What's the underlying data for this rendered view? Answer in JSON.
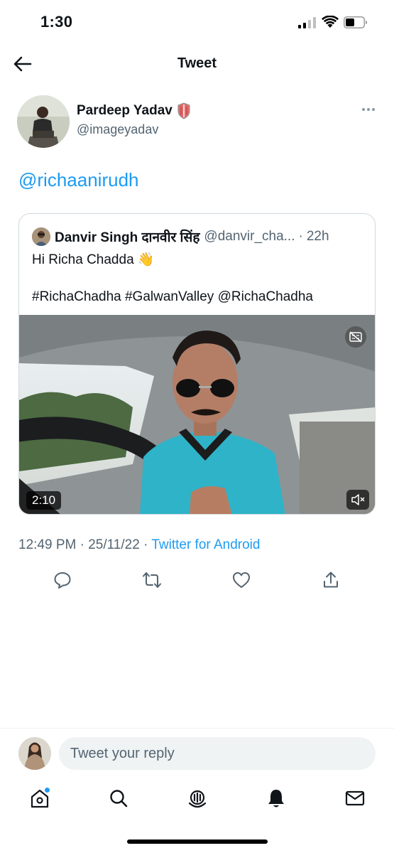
{
  "status_bar": {
    "time": "1:30"
  },
  "header": {
    "title": "Tweet"
  },
  "tweet": {
    "author_name": "Pardeep Yadav",
    "author_handle": "@imageyadav",
    "text": "@richaanirudh",
    "timestamp": "12:49 PM",
    "date": "25/11/22",
    "source": "Twitter for Android",
    "separator": "·"
  },
  "quoted_tweet": {
    "author_name": "Danvir Singh दानवीर सिंह",
    "author_handle": "@danvir_cha...",
    "age": "22h",
    "separator": "·",
    "line1": "Hi Richa Chadda 👋",
    "line2": "#RichaChadha #GalwanValley @RichaChadha",
    "video_duration": "2:10"
  },
  "reply": {
    "placeholder": "Tweet your reply"
  },
  "icons": {
    "back": "arrow-left-icon",
    "more": "more-icon",
    "reply": "comment-icon",
    "retweet": "retweet-icon",
    "like": "heart-icon",
    "share": "share-icon",
    "home": "home-icon",
    "search": "search-icon",
    "spaces": "spaces-icon",
    "notifications": "bell-icon",
    "messages": "mail-icon"
  },
  "colors": {
    "accent": "#1d9bf0",
    "secondary_text": "#536471",
    "primary_text": "#0f1419",
    "border": "#cfd9de"
  }
}
